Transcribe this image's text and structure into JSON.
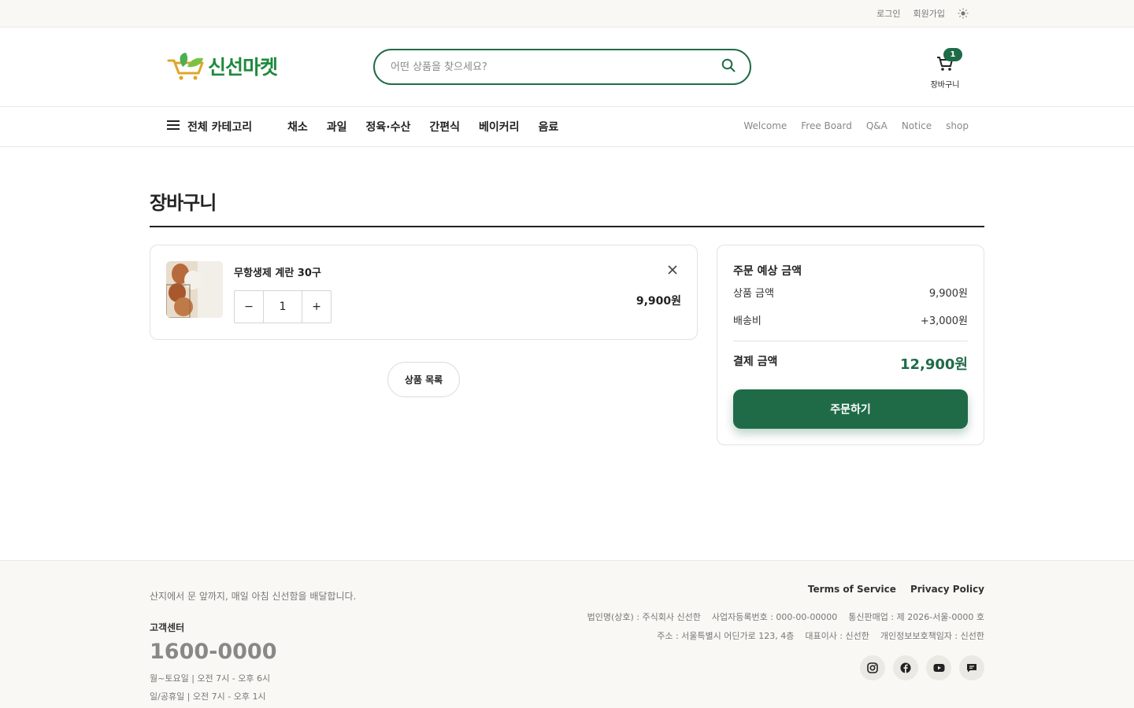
{
  "topbar": {
    "login": "로그인",
    "signup": "회원가입",
    "theme_icon": "sun-icon"
  },
  "header": {
    "logo_text": "신선마켓",
    "search_placeholder": "어떤 상품을 찾으세요?",
    "cart_count": "1",
    "cart_label": "장바구니"
  },
  "nav": {
    "all_categories": "전체 카테고리",
    "categories": [
      "채소",
      "과일",
      "정육·수산",
      "간편식",
      "베이커리",
      "음료"
    ],
    "links": [
      "Welcome",
      "Free Board",
      "Q&A",
      "Notice",
      "shop"
    ]
  },
  "page": {
    "title": "장바구니"
  },
  "cart_item": {
    "name": "무항생제 계란 30구",
    "quantity": "1",
    "minus": "−",
    "plus": "+",
    "price": "9,900원"
  },
  "product_list_button": "상품 목록",
  "summary": {
    "title": "주문 예상 금액",
    "product_label": "상품 금액",
    "product_value": "9,900원",
    "shipping_label": "배송비",
    "shipping_value": "+3,000원",
    "total_label": "결제 금액",
    "total_value": "12,900원",
    "order_button": "주문하기"
  },
  "footer": {
    "slogan": "산지에서 문 앞까지, 매일 아침 신선함을 배달합니다.",
    "cs_label": "고객센터",
    "phone": "1600-0000",
    "hours_weekday": "월~토요일 | 오전 7시 - 오후 6시",
    "hours_holiday": "일/공휴일 | 오전 7시 - 오후 1시",
    "terms": "Terms of Service",
    "privacy": "Privacy Policy",
    "info_line1": "법인명(상호) : 주식회사 신선한    사업자등록번호 : 000-00-00000    통신판매업 : 제 2026-서울-0000 호",
    "info_line2": "주소 : 서울특별시 어딘가로 123, 4층    대표이사 : 신선한    개인정보보호책임자 : 신선한"
  },
  "colors": {
    "brand": "#1f6b48",
    "logo": "#1e8a3c",
    "footer_bg": "#f9f8f4"
  }
}
